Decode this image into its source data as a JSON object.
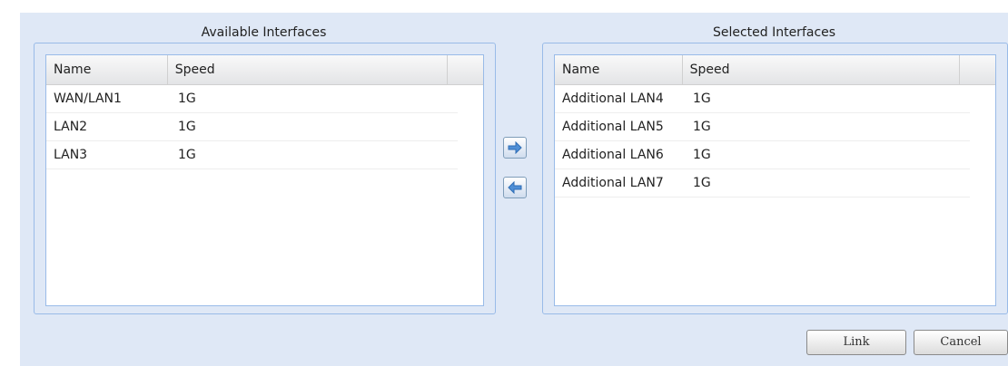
{
  "available": {
    "title": "Available Interfaces",
    "columns": {
      "name": "Name",
      "speed": "Speed"
    },
    "rows": [
      {
        "name": "WAN/LAN1",
        "speed": "1G"
      },
      {
        "name": "LAN2",
        "speed": "1G"
      },
      {
        "name": "LAN3",
        "speed": "1G"
      }
    ]
  },
  "selected": {
    "title": "Selected Interfaces",
    "columns": {
      "name": "Name",
      "speed": "Speed"
    },
    "rows": [
      {
        "name": "Additional LAN4",
        "speed": "1G"
      },
      {
        "name": "Additional LAN5",
        "speed": "1G"
      },
      {
        "name": "Additional LAN6",
        "speed": "1G"
      },
      {
        "name": "Additional LAN7",
        "speed": "1G"
      }
    ]
  },
  "transfer": {
    "add_icon": "arrow-right-icon",
    "remove_icon": "arrow-left-icon"
  },
  "actions": {
    "link_label": "Link",
    "cancel_label": "Cancel"
  },
  "colors": {
    "panel_background": "#dfe8f6",
    "border": "#99bbe8",
    "arrow": "#4f8fd6"
  }
}
